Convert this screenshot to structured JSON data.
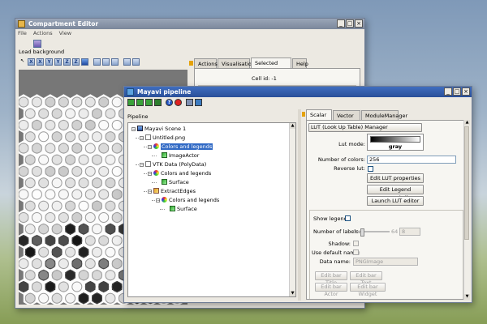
{
  "compartment": {
    "title": "Compartment Editor",
    "menu": [
      "File",
      "Actions",
      "View"
    ],
    "load_background": "Load background",
    "toolbar_icons": [
      "interact-icon",
      "view-x-icon",
      "view-x-icon",
      "view-y-icon",
      "view-y-icon",
      "view-z-icon",
      "view-z-icon",
      "iso-view-icon",
      "bar-icon",
      "scale-icon",
      "fullscreen-icon",
      "save-icon",
      "settings-icon"
    ],
    "toolbar_letters": [
      "",
      "X",
      "X",
      "Y",
      "Y",
      "Z",
      "Z",
      "",
      "",
      "",
      "",
      "",
      ""
    ],
    "tabs": [
      "Actions",
      "Visualisation",
      "Selected center",
      "Help"
    ],
    "selected_tab": "Selected center",
    "cell_id": "Cell id: -1"
  },
  "mayavi": {
    "title": "Mayavi pipeline",
    "pipeline_label": "Pipeline",
    "toolbar_icons": [
      "add-scene-icon",
      "add-source-icon",
      "add-filter-icon",
      "add-module-icon",
      "help-icon",
      "record-icon",
      "save-icon",
      "reload-icon"
    ],
    "tree": [
      {
        "label": "Mayavi Scene 1",
        "depth": 0,
        "icon": "scene-icon",
        "expander": "-"
      },
      {
        "label": "Untitled.png",
        "depth": 1,
        "icon": "file-icon",
        "expander": "-"
      },
      {
        "label": "Colors and legends",
        "depth": 2,
        "icon": "colors-legends-icon",
        "expander": "-",
        "selected": true
      },
      {
        "label": "ImageActor",
        "depth": 3,
        "icon": "module-icon",
        "expander": ""
      },
      {
        "label": "VTK Data (PolyData)",
        "depth": 1,
        "icon": "file-icon",
        "expander": "-"
      },
      {
        "label": "Colors and legends",
        "depth": 2,
        "icon": "colors-legends-icon",
        "expander": "-"
      },
      {
        "label": "Surface",
        "depth": 3,
        "icon": "module-icon",
        "expander": ""
      },
      {
        "label": "ExtractEdges",
        "depth": 2,
        "icon": "filter-icon",
        "expander": "-"
      },
      {
        "label": "Colors and legends",
        "depth": 3,
        "icon": "colors-legends-icon",
        "expander": "-"
      },
      {
        "label": "Surface",
        "depth": 4,
        "icon": "module-icon",
        "expander": ""
      }
    ],
    "tabs": [
      "Scalar LUT",
      "Vector LUT",
      "ModuleManager"
    ],
    "selected_tab": "Scalar LUT",
    "lut_manager_button": "LUT (Look Up Table) Manager",
    "lut_mode_label": "Lut mode:",
    "lut_mode_value": "gray",
    "num_colors_label": "Number of colors:",
    "num_colors_value": "256",
    "reverse_lut_label": "Reverse lut:",
    "edit_lut_properties": "Edit LUT properties",
    "edit_legend_representation": "Edit Legend representation",
    "launch_lut_editor": "Launch LUT editor",
    "show_legend_label": "Show legend:",
    "num_labels_label": "Number of labels:",
    "num_labels_min": "0",
    "num_labels_max": "64",
    "num_labels_value": "8",
    "shadow_label": "Shadow:",
    "use_default_name_label": "Use default name:",
    "data_name_label": "Data name:",
    "data_name_value": "PNGImage",
    "edit_bar_title": "Edit bar Title",
    "edit_bar_text": "Edit bar Text",
    "edit_bar_actor": "Edit bar Actor",
    "edit_bar_widget": "Edit bar Widget"
  }
}
